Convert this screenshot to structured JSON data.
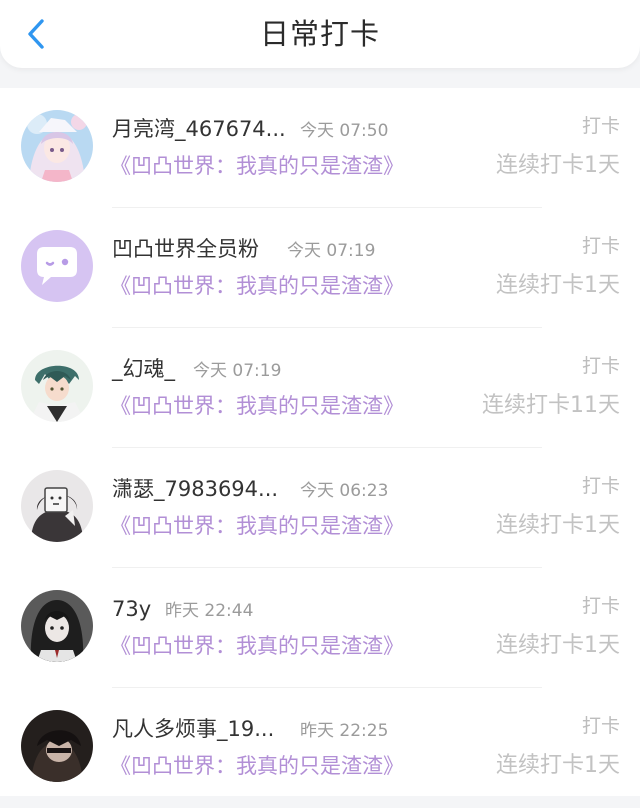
{
  "header": {
    "title": "日常打卡",
    "back_icon": "chevron-left-icon",
    "accent": "#2f96f0"
  },
  "items": [
    {
      "name": "月亮湾_467674...",
      "time": "今天 07:50",
      "book": "《凹凸世界：我真的只是渣渣》",
      "tag": "打卡",
      "streak": "连续打卡1天",
      "avatar": "anime-girl-avatar"
    },
    {
      "name": "凹凸世界全员粉",
      "time": "今天 07:19",
      "book": "《凹凸世界：我真的只是渣渣》",
      "tag": "打卡",
      "streak": "连续打卡1天",
      "avatar": "chat-bubble-avatar"
    },
    {
      "name": "_幻魂_",
      "time": "今天 07:19",
      "book": "《凹凸世界：我真的只是渣渣》",
      "tag": "打卡",
      "streak": "连续打卡11天",
      "avatar": "anime-boy-avatar"
    },
    {
      "name": "潇瑟_7983694...",
      "time": "今天 06:23",
      "book": "《凹凸世界：我真的只是渣渣》",
      "tag": "打卡",
      "streak": "连续打卡1天",
      "avatar": "sketch-avatar"
    },
    {
      "name": "73y",
      "time": "昨天 22:44",
      "book": "《凹凸世界：我真的只是渣渣》",
      "tag": "打卡",
      "streak": "连续打卡1天",
      "avatar": "dark-hair-girl-avatar"
    },
    {
      "name": "凡人多烦事_19...",
      "time": "昨天 22:25",
      "book": "《凹凸世界：我真的只是渣渣》",
      "tag": "打卡",
      "streak": "连续打卡1天",
      "avatar": "dark-photo-avatar"
    }
  ]
}
